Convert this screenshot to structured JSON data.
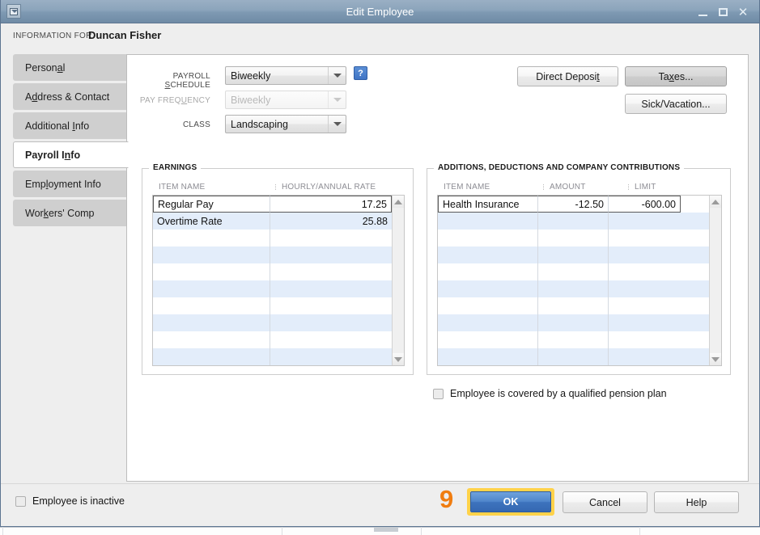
{
  "window": {
    "title": "Edit Employee",
    "icon": "window-menu-icon",
    "minimize": "–",
    "maximize": "□",
    "close": "✕"
  },
  "header": {
    "info_label": "INFORMATION FOR",
    "employee_name": "Duncan Fisher"
  },
  "tabs": [
    {
      "label_pre": "Person",
      "mnemonic": "a",
      "label_post": "l",
      "active": false,
      "name": "personal"
    },
    {
      "label_pre": "A",
      "mnemonic": "d",
      "label_post": "dress & Contact",
      "active": false,
      "name": "address-contact"
    },
    {
      "label_pre": "Additional ",
      "mnemonic": "I",
      "label_post": "nfo",
      "active": false,
      "name": "additional-info"
    },
    {
      "label_pre": "Payroll I",
      "mnemonic": "n",
      "label_post": "fo",
      "active": true,
      "name": "payroll-info"
    },
    {
      "label_pre": "Emp",
      "mnemonic": "l",
      "label_post": "oyment Info",
      "active": false,
      "name": "employment-info"
    },
    {
      "label_pre": "Wor",
      "mnemonic": "k",
      "label_post": "ers' Comp",
      "active": false,
      "name": "workers-comp"
    }
  ],
  "fields": {
    "payroll_schedule": {
      "label_pre": "PAYROLL ",
      "mnemonic": "S",
      "label_post": "CHEDULE",
      "value": "Biweekly",
      "disabled": false
    },
    "pay_frequency": {
      "label_pre": "PAY FREQ",
      "mnemonic": "U",
      "label_post": "ENCY",
      "value": "Biweekly",
      "disabled": true
    },
    "class": {
      "label_pre": "CLASS",
      "mnemonic": "",
      "label_post": "",
      "value": "Landscaping",
      "disabled": false
    },
    "help_button": "?"
  },
  "actions": {
    "direct_deposit": {
      "pre": "Direct Deposi",
      "mnemonic": "t",
      "post": ""
    },
    "taxes": {
      "pre": "Ta",
      "mnemonic": "x",
      "post": "es..."
    },
    "sick_vacation": {
      "pre": "Sick/Vacation...",
      "mnemonic": "",
      "post": ""
    }
  },
  "earnings": {
    "title": "EARNINGS",
    "columns": [
      "ITEM NAME",
      "HOURLY/ANNUAL RATE"
    ],
    "rows": [
      {
        "item": "Regular Pay",
        "rate": "17.25",
        "selected": true
      },
      {
        "item": "Overtime Rate",
        "rate": "25.88",
        "selected": false
      },
      {
        "item": "",
        "rate": "",
        "selected": false
      },
      {
        "item": "",
        "rate": "",
        "selected": false
      },
      {
        "item": "",
        "rate": "",
        "selected": false
      },
      {
        "item": "",
        "rate": "",
        "selected": false
      },
      {
        "item": "",
        "rate": "",
        "selected": false
      },
      {
        "item": "",
        "rate": "",
        "selected": false
      },
      {
        "item": "",
        "rate": "",
        "selected": false
      },
      {
        "item": "",
        "rate": "",
        "selected": false
      }
    ]
  },
  "additions": {
    "title": "ADDITIONS, DEDUCTIONS AND COMPANY CONTRIBUTIONS",
    "columns": [
      "ITEM NAME",
      "AMOUNT",
      "LIMIT"
    ],
    "rows": [
      {
        "item": "Health Insurance",
        "amount": "-12.50",
        "limit": "-600.00",
        "selected": true
      },
      {
        "item": "",
        "amount": "",
        "limit": "",
        "selected": false
      },
      {
        "item": "",
        "amount": "",
        "limit": "",
        "selected": false
      },
      {
        "item": "",
        "amount": "",
        "limit": "",
        "selected": false
      },
      {
        "item": "",
        "amount": "",
        "limit": "",
        "selected": false
      },
      {
        "item": "",
        "amount": "",
        "limit": "",
        "selected": false
      },
      {
        "item": "",
        "amount": "",
        "limit": "",
        "selected": false
      },
      {
        "item": "",
        "amount": "",
        "limit": "",
        "selected": false
      },
      {
        "item": "",
        "amount": "",
        "limit": "",
        "selected": false
      },
      {
        "item": "",
        "amount": "",
        "limit": "",
        "selected": false
      }
    ]
  },
  "checkboxes": {
    "pension": {
      "label": "Employee is covered by a qualified pension plan",
      "checked": false
    },
    "inactive": {
      "label": "Employee is inactive",
      "checked": false
    }
  },
  "footer": {
    "step_marker": "9",
    "ok": "OK",
    "cancel": "Cancel",
    "help": "Help"
  },
  "colors": {
    "titlebar": "#8ba4bb",
    "accent_blue": "#3f74c4",
    "marker_orange": "#f07d10",
    "highlight_yellow": "#ffd24a",
    "row_stripe": "#e3edfa"
  }
}
